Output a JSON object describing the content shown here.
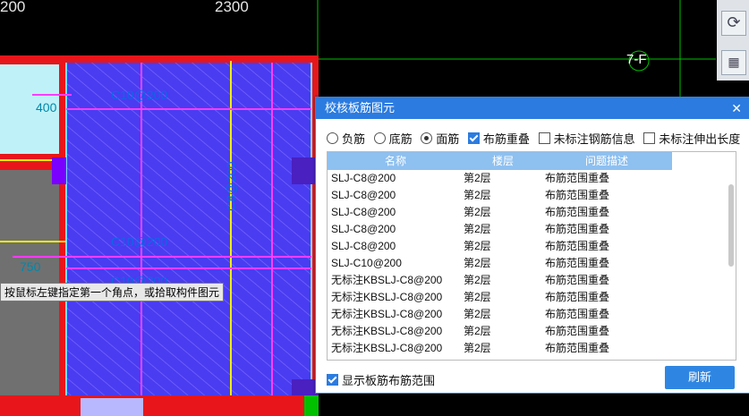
{
  "cad": {
    "dim_top_left": "200",
    "dim_top_center": "2300",
    "axis_label": "7-F",
    "dim_400": "400",
    "dim_750": "750",
    "rebar_label_1": "C10@200",
    "rebar_label_2": "C10@200",
    "rebar_label_3": "C10@200",
    "rebar_label_vertical": "C8@200",
    "command_tip": "按鼠标左键指定第一个角点，或拾取构件图元"
  },
  "right_toolbar": {
    "refresh_icon": "refresh-icon",
    "grid_icon": "grid-icon"
  },
  "dialog": {
    "title": "校核板筋图元",
    "close_glyph": "✕",
    "options": [
      {
        "label": "负筋",
        "type": "radio",
        "checked": false
      },
      {
        "label": "底筋",
        "type": "radio",
        "checked": false
      },
      {
        "label": "面筋",
        "type": "radio",
        "checked": true
      },
      {
        "label": "布筋重叠",
        "type": "checkbox",
        "checked": true
      },
      {
        "label": "未标注钢筋信息",
        "type": "checkbox",
        "checked": false
      },
      {
        "label": "未标注伸出长度",
        "type": "checkbox",
        "checked": false
      }
    ],
    "columns": [
      "名称",
      "楼层",
      "问题描述"
    ],
    "rows": [
      [
        "SLJ-C8@200",
        "第2层",
        "布筋范围重叠"
      ],
      [
        "SLJ-C8@200",
        "第2层",
        "布筋范围重叠"
      ],
      [
        "SLJ-C8@200",
        "第2层",
        "布筋范围重叠"
      ],
      [
        "SLJ-C8@200",
        "第2层",
        "布筋范围重叠"
      ],
      [
        "SLJ-C8@200",
        "第2层",
        "布筋范围重叠"
      ],
      [
        "SLJ-C10@200",
        "第2层",
        "布筋范围重叠"
      ],
      [
        "无标注KBSLJ-C8@200",
        "第2层",
        "布筋范围重叠"
      ],
      [
        "无标注KBSLJ-C8@200",
        "第2层",
        "布筋范围重叠"
      ],
      [
        "无标注KBSLJ-C8@200",
        "第2层",
        "布筋范围重叠"
      ],
      [
        "无标注KBSLJ-C8@200",
        "第2层",
        "布筋范围重叠"
      ],
      [
        "无标注KBSLJ-C8@200",
        "第2层",
        "布筋范围重叠"
      ]
    ],
    "show_range_label": "显示板筋布筋范围",
    "show_range_checked": true,
    "refresh_label": "刷新"
  },
  "colors": {
    "slab_fill": "#4a3cf0",
    "beam_red": "#e8161a",
    "column_gray": "#707070",
    "magenta_line": "#ff3cff",
    "yellow_line": "#f0f000",
    "green_line": "#00d000",
    "dialog_blue": "#2b7be0"
  }
}
